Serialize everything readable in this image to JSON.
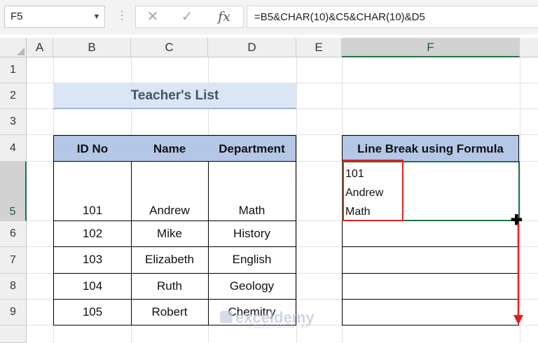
{
  "formula_bar": {
    "name_box": "F5",
    "cancel_icon": "✕",
    "enter_icon": "✓",
    "fx_label": "fx",
    "formula": "=B5&CHAR(10)&C5&CHAR(10)&D5"
  },
  "columns": [
    "A",
    "B",
    "C",
    "D",
    "E",
    "F"
  ],
  "rows": [
    "1",
    "2",
    "3",
    "4",
    "5",
    "6",
    "7",
    "8",
    "9"
  ],
  "title": "Teacher's List",
  "table": {
    "headers": [
      "ID No",
      "Name",
      "Department"
    ],
    "rows": [
      [
        "101",
        "Andrew",
        "Math"
      ],
      [
        "102",
        "Mike",
        "History"
      ],
      [
        "103",
        "Elizabeth",
        "English"
      ],
      [
        "104",
        "Ruth",
        "Geology"
      ],
      [
        "105",
        "Robert",
        "Chemitry"
      ]
    ]
  },
  "result": {
    "header": "Line Break using Formula",
    "lines": [
      "101",
      "Andrew",
      "Math"
    ]
  },
  "watermark": {
    "name": "exceldemy",
    "tagline": "EXCEL · DATA · BI"
  },
  "colors": {
    "table_header": "#b4c7e7",
    "title_fill": "#dbe5f3",
    "selection": "#217346",
    "highlight": "#e02020"
  },
  "icons": {
    "name_box_dropdown": "chevron-down-icon",
    "cancel": "close-icon",
    "enter": "check-icon",
    "function": "fx-icon",
    "fill_handle": "crosshair-cursor-icon",
    "fill_arrow": "arrow-down-icon"
  }
}
